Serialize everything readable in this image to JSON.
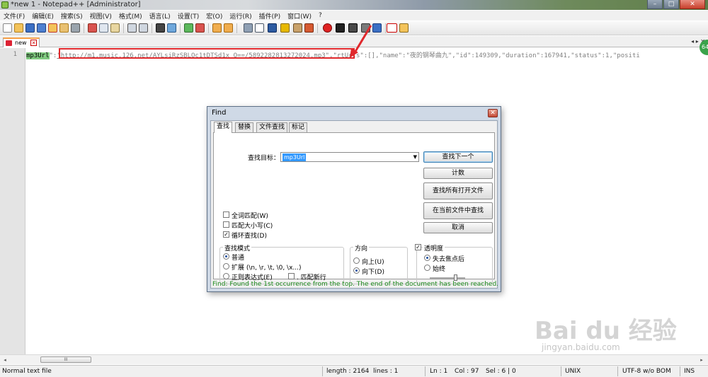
{
  "window": {
    "title": "*new  1 - Notepad++ [Administrator]",
    "controls": {
      "minimize": "–",
      "maximize": "□",
      "close": "✕"
    }
  },
  "menu": [
    "文件(F)",
    "编辑(E)",
    "搜索(S)",
    "视图(V)",
    "格式(M)",
    "语言(L)",
    "设置(T)",
    "宏(O)",
    "运行(R)",
    "插件(P)",
    "窗口(W)",
    "?"
  ],
  "tabs": [
    {
      "label": "new",
      "close": "✕"
    }
  ],
  "tab_nav": "◂ ▸ ✕",
  "editor": {
    "line_number": "1",
    "key": "mp3Url",
    "sep1": "\":",
    "url": "\"http://m1.music.126.net/AYLsiRzSBLOc1tDTSd1x_Q==/5892282813272024.mp3\"",
    "rest": ",\"rtUrls\":[],\"name\":\"夜的钢琴曲九\",\"id\":149309,\"duration\":167941,\"status\":1,\"positi"
  },
  "badge": "64",
  "scrollbar": {
    "left": "◂",
    "right": "▸",
    "thumb": "III"
  },
  "status_bar": {
    "file_type": "Normal text file",
    "length": "length : 2164",
    "lines": "lines : 1",
    "ln": "Ln : 1",
    "col": "Col : 97",
    "sel": "Sel : 6 | 0",
    "eol": "UNIX",
    "encoding": "UTF-8 w/o BOM",
    "mode": "INS"
  },
  "find_dialog": {
    "title": "Find",
    "close": "✕",
    "tabs": [
      "查找",
      "替换",
      "文件查找",
      "标记"
    ],
    "find_label": "查找目标：",
    "find_value": "mp3Url",
    "buttons": {
      "find_next": "查找下一个",
      "count": "计数",
      "find_all_open": "查找所有打开文件",
      "find_in_current": "在当前文件中查找",
      "cancel": "取消"
    },
    "options": {
      "whole_word": "全词匹配(W)",
      "match_case": "匹配大小写(C)",
      "wrap_around": "循环查找(D)"
    },
    "search_mode": {
      "title": "查找模式",
      "normal": "普通",
      "extended": "扩展 (\\n, \\r, \\t, \\0, \\x...)",
      "regex": "正则表达式(E)",
      "dot_newline": ". 匹配新行"
    },
    "direction": {
      "title": "方向",
      "up": "向上(U)",
      "down": "向下(D)"
    },
    "transparency": {
      "title": "透明度",
      "on_lose_focus": "失去焦点后",
      "always": "始终"
    },
    "status": "Find: Found the 1st occurrence from the top. The end of the document has been reached."
  },
  "watermark": {
    "logo": "Bai du 经验",
    "url": "jingyan.baidu.com"
  }
}
